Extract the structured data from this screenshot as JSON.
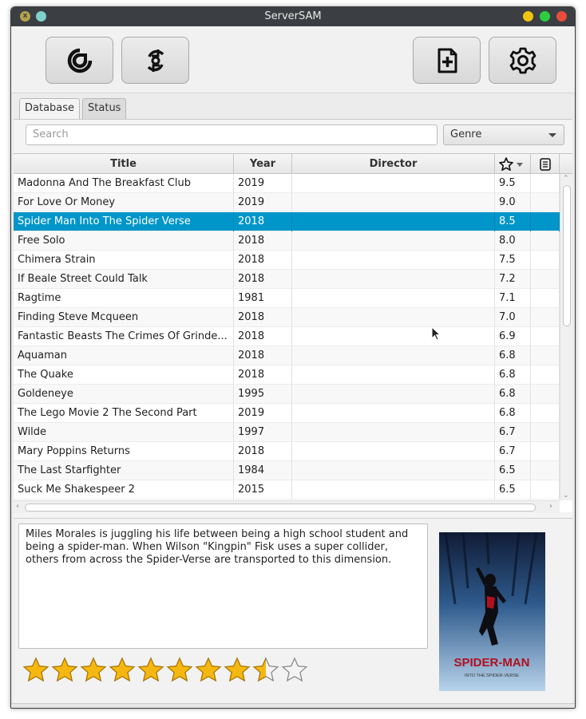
{
  "window": {
    "title": "ServerSAM",
    "close_glyph": "x"
  },
  "toolbar": {
    "buttons": [
      {
        "name": "refresh",
        "icon": "refresh-icon"
      },
      {
        "name": "sync",
        "icon": "sync-icon"
      },
      {
        "name": "add",
        "icon": "add-file-icon"
      },
      {
        "name": "settings",
        "icon": "gear-icon"
      }
    ]
  },
  "tabs": [
    {
      "label": "Database",
      "active": true
    },
    {
      "label": "Status",
      "active": false
    }
  ],
  "search": {
    "placeholder": "Search",
    "value": ""
  },
  "genre": {
    "selected": "Genre"
  },
  "table": {
    "columns": [
      "Title",
      "Year",
      "Director",
      "",
      ""
    ],
    "rating_header_icon": "star-sort-icon",
    "menu_header_icon": "column-menu-icon",
    "rows": [
      {
        "title": "Madonna And The Breakfast Club",
        "year": "2019",
        "director": "",
        "rating": "9.5"
      },
      {
        "title": "For Love Or Money",
        "year": "2019",
        "director": "",
        "rating": "9.0"
      },
      {
        "title": "Spider Man Into The Spider Verse",
        "year": "2018",
        "director": "",
        "rating": "8.5",
        "selected": true
      },
      {
        "title": "Free Solo",
        "year": "2018",
        "director": "",
        "rating": "8.0"
      },
      {
        "title": "Chimera Strain",
        "year": "2018",
        "director": "",
        "rating": "7.5"
      },
      {
        "title": "If Beale Street Could Talk",
        "year": "2018",
        "director": "",
        "rating": "7.2"
      },
      {
        "title": "Ragtime",
        "year": "1981",
        "director": "",
        "rating": "7.1"
      },
      {
        "title": "Finding Steve Mcqueen",
        "year": "2018",
        "director": "",
        "rating": "7.0"
      },
      {
        "title": "Fantastic Beasts The Crimes Of Grinde...",
        "year": "2018",
        "director": "",
        "rating": "6.9"
      },
      {
        "title": "Aquaman",
        "year": "2018",
        "director": "",
        "rating": "6.8"
      },
      {
        "title": "The Quake",
        "year": "2018",
        "director": "",
        "rating": "6.8"
      },
      {
        "title": "Goldeneye",
        "year": "1995",
        "director": "",
        "rating": "6.8"
      },
      {
        "title": "The Lego Movie 2 The Second Part",
        "year": "2019",
        "director": "",
        "rating": "6.8"
      },
      {
        "title": "Wilde",
        "year": "1997",
        "director": "",
        "rating": "6.7"
      },
      {
        "title": "Mary Poppins Returns",
        "year": "2018",
        "director": "",
        "rating": "6.7"
      },
      {
        "title": "The Last Starfighter",
        "year": "1984",
        "director": "",
        "rating": "6.5"
      },
      {
        "title": "Suck Me Shakespeer 2",
        "year": "2015",
        "director": "",
        "rating": "6.5"
      }
    ]
  },
  "details": {
    "description": "Miles Morales is juggling his life between being a high school student and being a spider-man. When Wilson \"Kingpin\" Fisk uses a super collider, others from across the Spider-Verse are transported to this dimension.",
    "rating_stars": 8.5,
    "max_stars": 10,
    "poster": {
      "title": "SPIDER-MAN",
      "subtitle": "INTO THE SPIDER-VERSE"
    }
  },
  "colors": {
    "selection": "#0096c9",
    "titlebar": "#3b3f43",
    "star_fill": "#f5b812"
  }
}
